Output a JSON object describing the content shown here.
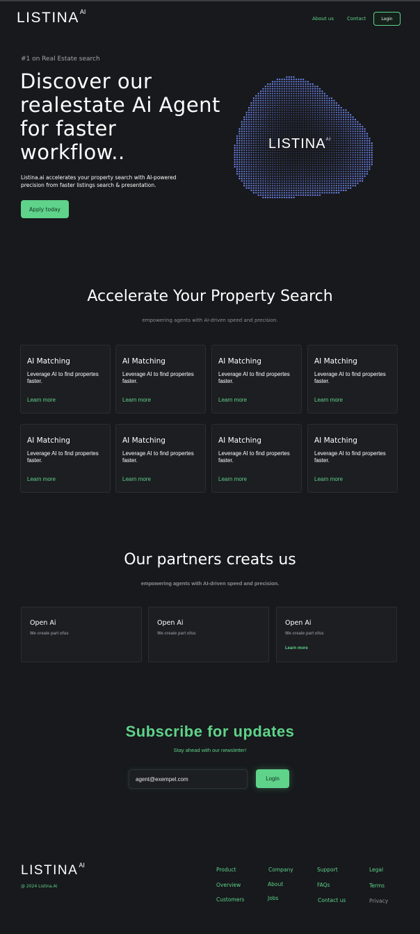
{
  "brand": {
    "logo_text": "LISTINA",
    "logo_sup": "AI"
  },
  "nav": {
    "about": "About us",
    "contact": "Contact",
    "login": "Login"
  },
  "hero": {
    "kicker": "#1 on Real Estate search",
    "title": "Discover our realestate Ai Agent for faster workflow..",
    "description": "Listina.ai accelerates your property search with AI-powered precision from faster listings search & presentation.",
    "cta": "Apply today",
    "orb_label": "LISTINA",
    "orb_sup": "AI"
  },
  "features": {
    "title": "Accelerate Your Property Search",
    "subtitle": "empowering agents with AI-driven speed and precision.",
    "cards": [
      {
        "title": "AI Matching",
        "desc": "Leverage AI to find propertes faster.",
        "link": "Learn more"
      },
      {
        "title": "AI Matching",
        "desc": "Leverage AI to find propertes faster.",
        "link": "Learn more"
      },
      {
        "title": "AI Matching",
        "desc": "Leverage AI to find propertes faster.",
        "link": "Learn more"
      },
      {
        "title": "AI Matching",
        "desc": "Leverage AI to find propertes faster.",
        "link": "Learn more"
      },
      {
        "title": "AI Matching",
        "desc": "Leverage AI to find propertes faster.",
        "link": "Learn more"
      },
      {
        "title": "AI Matching",
        "desc": "Leverage AI to find propertes faster.",
        "link": "Learn more"
      },
      {
        "title": "AI Matching",
        "desc": "Leverage AI to find propertes faster.",
        "link": "Learn more"
      },
      {
        "title": "AI Matching",
        "desc": "Leverage AI to find propertes faster.",
        "link": "Learn more"
      }
    ]
  },
  "partners": {
    "title": "Our partners creats us",
    "subtitle": "empowering agents with AI-driven speed and precision.",
    "cards": [
      {
        "title": "Open Ai",
        "desc": "We create part ofus"
      },
      {
        "title": "Open Ai",
        "desc": "We create part ofus"
      },
      {
        "title": "Open Ai",
        "desc": "We create part ofus",
        "link": "Learn more"
      }
    ]
  },
  "subscribe": {
    "title": "Subscribe for updates",
    "tagline": "Stay ahead with our newsletter!",
    "email_value": "agent@exempel.com",
    "button": "Login"
  },
  "footer": {
    "logo_text": "LISTINA",
    "logo_sup": "AI",
    "copyright": "@ 2024 Listina.Ai",
    "columns": [
      {
        "items": [
          "Product",
          "Overview",
          "Customers"
        ]
      },
      {
        "items": [
          "Company",
          "About",
          "Jobs"
        ]
      },
      {
        "items": [
          "Support",
          "FAQs",
          "Contact us"
        ]
      },
      {
        "items": [
          "Legal",
          "Terms",
          "Privacy"
        ]
      }
    ]
  },
  "colors": {
    "accent": "#5fd38a",
    "background": "#17191c",
    "card": "#1c1e22"
  }
}
